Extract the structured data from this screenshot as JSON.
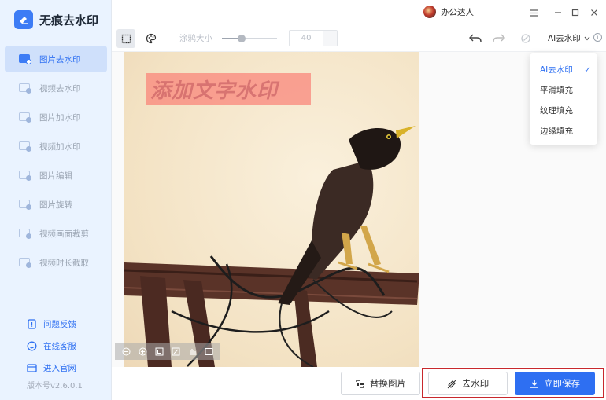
{
  "app": {
    "name": "无痕去水印",
    "version": "版本号v2.6.0.1"
  },
  "user": {
    "name": "办公达人"
  },
  "sidebar": {
    "items": [
      {
        "label": "图片去水印",
        "active": true
      },
      {
        "label": "视频去水印",
        "active": false
      },
      {
        "label": "图片加水印",
        "active": false
      },
      {
        "label": "视频加水印",
        "active": false
      },
      {
        "label": "图片编辑",
        "active": false
      },
      {
        "label": "图片旋转",
        "active": false
      },
      {
        "label": "视频画面裁剪",
        "active": false
      },
      {
        "label": "视频时长截取",
        "active": false
      }
    ],
    "links": [
      {
        "label": "问题反馈",
        "icon": "feedback-icon"
      },
      {
        "label": "在线客服",
        "icon": "service-icon"
      },
      {
        "label": "进入官网",
        "icon": "website-icon"
      }
    ]
  },
  "toolbar": {
    "brush_label": "涂鸦大小",
    "brush_value": "40",
    "brush_level": 0.35,
    "mode": "AI去水印"
  },
  "mode_menu": {
    "options": [
      {
        "label": "AI去水印",
        "selected": true
      },
      {
        "label": "平滑填充",
        "selected": false
      },
      {
        "label": "纹理填充",
        "selected": false
      },
      {
        "label": "边缘填充",
        "selected": false
      }
    ]
  },
  "image": {
    "watermark_text": "添加文字水印"
  },
  "actions": {
    "replace": "替换图片",
    "remove": "去水印",
    "save": "立即保存"
  },
  "colors": {
    "accent": "#2e6ff2",
    "sidebar_bg": "#eaf3ff",
    "highlight": "#c8282d",
    "watermark": "#fa786e"
  }
}
